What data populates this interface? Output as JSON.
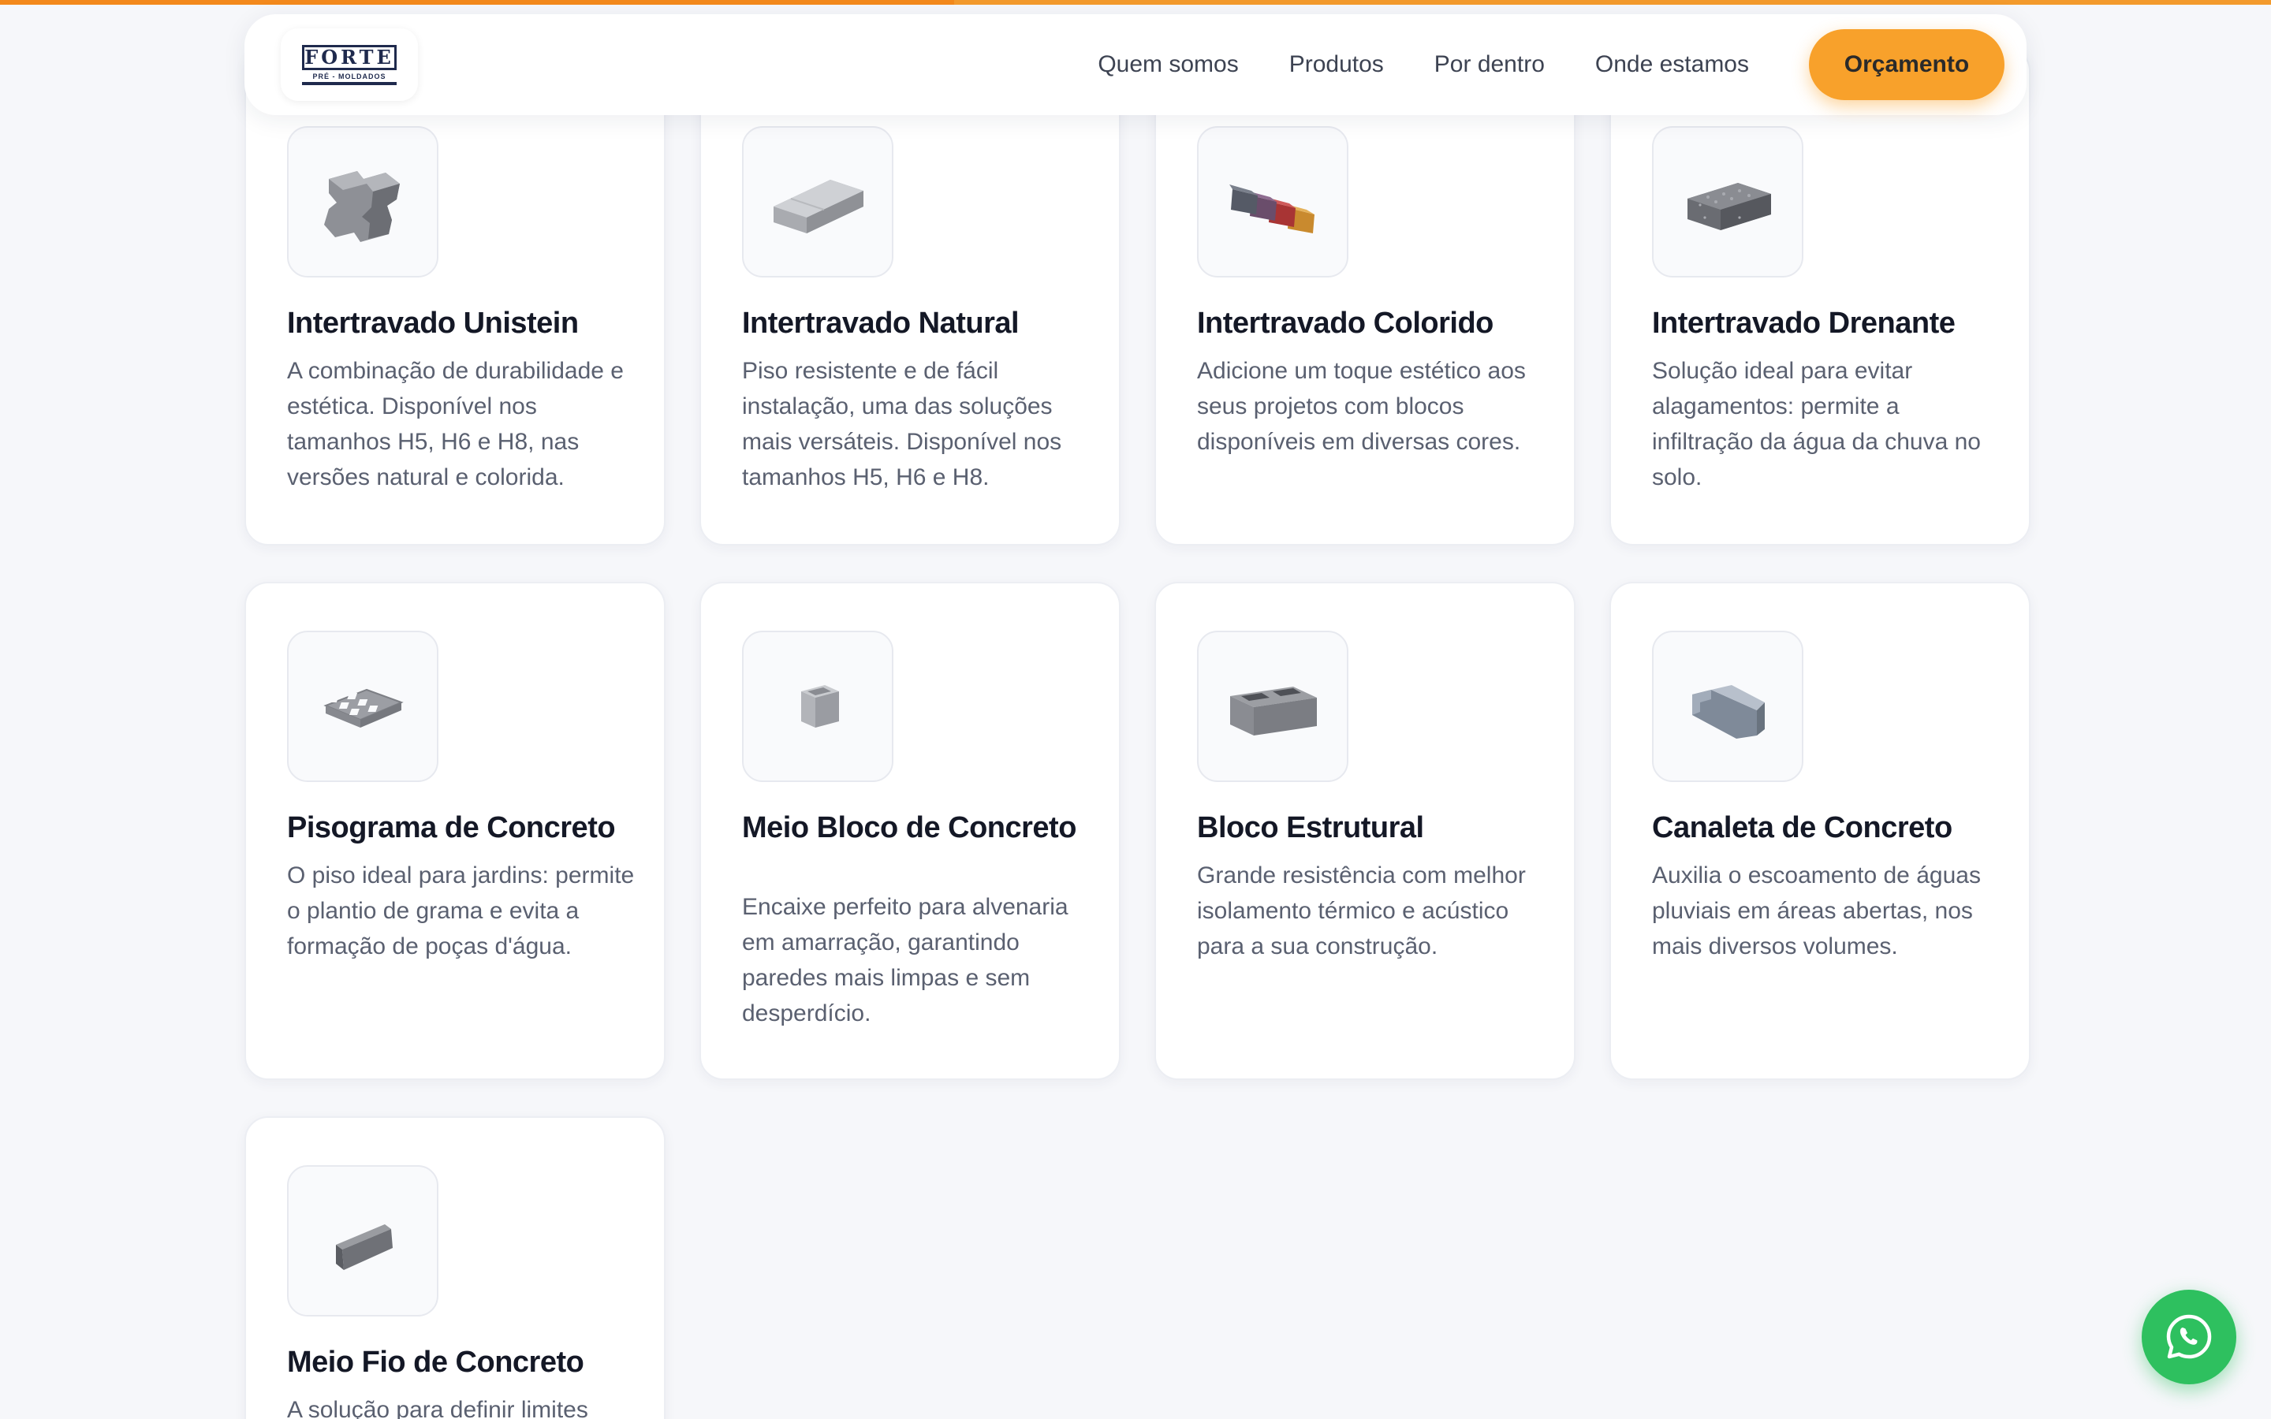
{
  "progress": 0.42,
  "brand": {
    "logo_title": "FORTE",
    "logo_subtitle": "PRÉ - MOLDADOS",
    "colors": {
      "accent": "#f8a12b",
      "whatsapp": "#2ec05f",
      "text": "#141826"
    }
  },
  "nav": {
    "links": [
      "Quem somos",
      "Produtos",
      "Por dentro",
      "Onde estamos"
    ],
    "cta_label": "Orçamento"
  },
  "products": [
    {
      "title": "Intertravado Unistein",
      "description": "A combinação de durabilidade e estética. Disponível nos tamanhos H5, H6 e H8, nas versões natural e colorida.",
      "icon": "unistein-paver-icon"
    },
    {
      "title": "Intertravado Natural",
      "description": "Piso resistente e de fácil instalação, uma das soluções mais versáteis. Disponível nos tamanhos H5, H6 e H8.",
      "icon": "rectangular-paver-icon"
    },
    {
      "title": "Intertravado Colorido",
      "description": "Adicione um toque estético aos seus projetos com blocos disponíveis em diversas cores.",
      "icon": "colored-pavers-icon"
    },
    {
      "title": "Intertravado Drenante",
      "description": "Solução ideal para evitar alagamentos: permite a infiltração da água da chuva no solo.",
      "icon": "draining-paver-icon"
    },
    {
      "title": "Pisograma de Concreto",
      "description": "O piso ideal para jardins: permite o plantio de grama e evita a formação de poças d'água.",
      "icon": "grass-paver-icon"
    },
    {
      "title": "Meio Bloco de Concreto",
      "description": "Encaixe perfeito para alvenaria em amarração, garantindo paredes mais limpas e sem desperdício.",
      "icon": "half-block-icon"
    },
    {
      "title": "Bloco Estrutural",
      "description": "Grande resistência com melhor isolamento térmico e acústico para a sua construção.",
      "icon": "structural-block-icon"
    },
    {
      "title": "Canaleta de Concreto",
      "description": "Auxilia o escoamento de águas pluviais em áreas abertas, nos mais diversos volumes.",
      "icon": "concrete-channel-icon"
    },
    {
      "title": "Meio Fio de Concreto",
      "description": "A solução para definir limites",
      "icon": "curb-icon"
    }
  ],
  "whatsapp_icon": "whatsapp-icon"
}
